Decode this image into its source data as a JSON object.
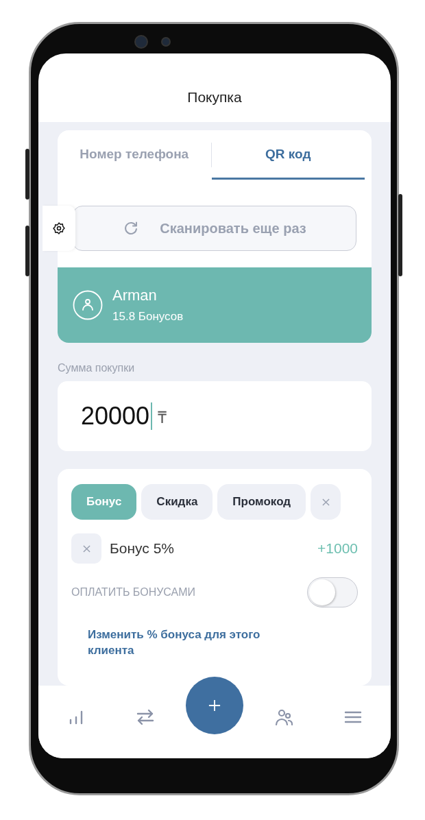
{
  "header": {
    "title": "Покупка"
  },
  "tabs": [
    {
      "label": "Номер телефона",
      "selected": false
    },
    {
      "label": "QR код",
      "selected": true
    }
  ],
  "scan_button": {
    "label": "Сканировать еще раз"
  },
  "customer": {
    "name": "Arman",
    "bonuses": "15.8 Бонусов"
  },
  "purchase": {
    "label": "Сумма покупки",
    "value": "20000",
    "currency": "₸"
  },
  "modes": [
    {
      "label": "Бонус",
      "selected": true
    },
    {
      "label": "Скидка",
      "selected": false
    },
    {
      "label": "Промокод",
      "selected": false
    }
  ],
  "bonus": {
    "label": "Бонус 5%",
    "amount": "+1000"
  },
  "pay_with_bonuses": {
    "label": "ОПЛАТИТЬ БОНУСАМИ",
    "on": false
  },
  "change_link": "Изменить % бонуса для этого клиента",
  "nav": [
    {
      "kind": "stats"
    },
    {
      "kind": "transfers"
    },
    {
      "kind": "add"
    },
    {
      "kind": "clients"
    },
    {
      "kind": "menu"
    }
  ]
}
